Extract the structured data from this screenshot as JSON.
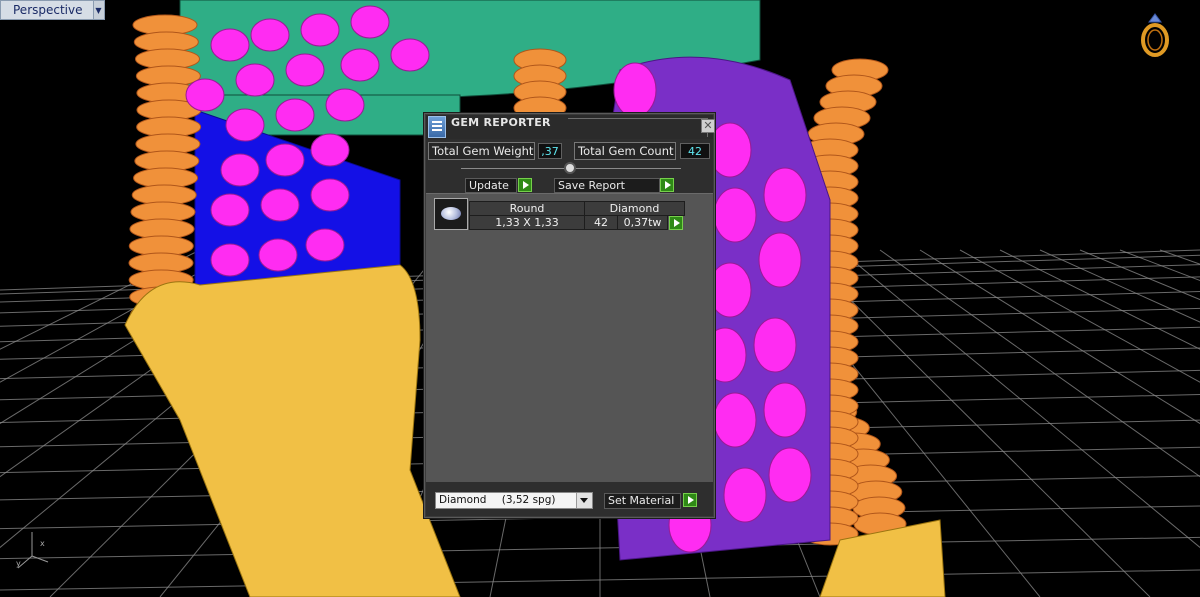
{
  "viewport": {
    "label": "Perspective",
    "dropdown_icon": "chevron-down-icon",
    "colors": {
      "background": "#000000",
      "grid": "#8c8c8c",
      "metal_orange": "#f0913a",
      "metal_yellow": "#f1c045",
      "metal_green": "#2fae86",
      "gem_magenta": "#ff2cf2",
      "gem_purple": "#7a2fc7",
      "blue_panel": "#1410e6"
    }
  },
  "dialog": {
    "title": "GEM REPORTER",
    "close_icon": "close-icon",
    "total_weight_label": "Total Gem Weight",
    "total_weight_value": ",37",
    "total_count_label": "Total Gem Count",
    "total_count_value": "42",
    "update_label": "Update",
    "save_report_label": "Save Report",
    "table": {
      "headers": [
        "Round",
        "Diamond"
      ],
      "rows": [
        {
          "size": "1,33 X 1,33",
          "count": "42",
          "weight": "0,37tw"
        }
      ]
    },
    "material_select_name": "Diamond",
    "material_select_spg": "(3,52 spg)",
    "set_material_label": "Set Material"
  }
}
